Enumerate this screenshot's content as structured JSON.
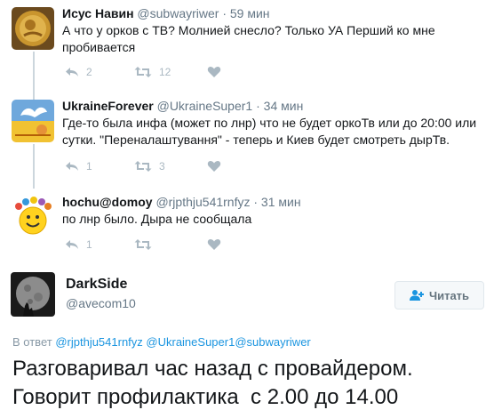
{
  "replies": [
    {
      "name": "Исус Навин",
      "handle": "@subwayriwer",
      "time": "· 59 мин",
      "text": "А что у орков с ТВ? Молнией снесло? Только УА Перший ко мне пробивается",
      "reply_count": "2",
      "retweet_count": "12",
      "like_count": ""
    },
    {
      "name": "UkraineForever",
      "handle": "@UkraineSuper1",
      "time": "· 34 мин",
      "text": "Где-то была инфа (может по лнр) что не будет оркоТв или до 20:00 или сутки. \"Переналаштування\" - теперь и Киев будет смотреть дырТв.",
      "reply_count": "1",
      "retweet_count": "3",
      "like_count": ""
    },
    {
      "name": "hochu@domoy",
      "handle": "@rjpthju541rnfyz",
      "time": "· 31 мин",
      "text": "по лнр было. Дыра не сообщала",
      "reply_count": "1",
      "retweet_count": "",
      "like_count": ""
    }
  ],
  "main_tweet": {
    "name": "DarkSide",
    "handle": "@avecom10",
    "follow_label": "Читать",
    "reply_to_prefix": "В ответ",
    "reply_to_mentions": "@rjpthju541rnfyz @UkraineSuper1@subwayriwer",
    "text": "Разговаривал час назад с провайдером. Говорит профилактика  с 2.00 до 14.00"
  },
  "icons": {
    "reply": "reply-icon",
    "retweet": "retweet-icon",
    "like": "heart-icon",
    "follow": "add-user-icon"
  },
  "colors": {
    "link": "#1b95e0",
    "muted": "#657786",
    "action": "#aab8c2",
    "thread_line": "#ccd6dd"
  }
}
